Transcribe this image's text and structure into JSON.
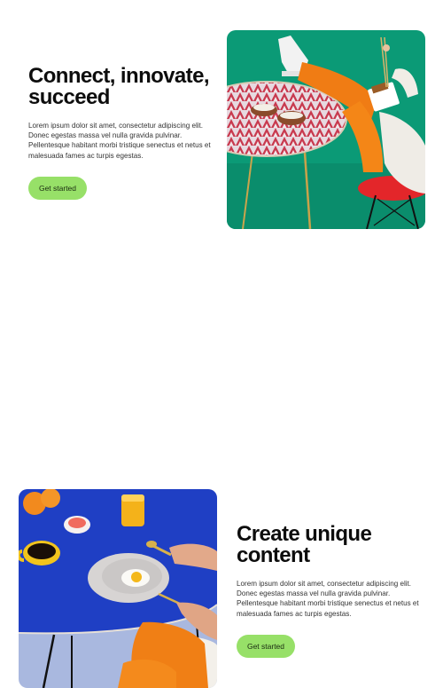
{
  "feature_1": {
    "title_line_1": "Connect, innovate,",
    "title_line_2": "succeed",
    "body": "Lorem ipsum dolor sit amet, consectetur adipiscing elit. Donec egestas massa vel nulla gravida pulvinar. Pellentesque habitant morbi tristique senectus et netus et malesuada fames ac turpis egestas.",
    "cta_label": "Get started",
    "image_icon": "photo-person-eating-at-patterned-table"
  },
  "feature_2": {
    "title_line_1": "Create unique",
    "title_line_2": "content",
    "body": "Lorem ipsum dolor sit amet, consectetur adipiscing elit. Donec egestas massa vel nulla gravida pulvinar. Pellentesque habitant morbi tristique senectus et netus et malesuada fames ac turpis egestas.",
    "cta_label": "Get started",
    "image_icon": "photo-breakfast-on-blue-table"
  },
  "colors": {
    "background": "#ffffff",
    "heading": "#0d0d0d",
    "body_text": "#333333",
    "cta_background": "#97e068",
    "photo_1_backdrop": "#0b9a76",
    "photo_2_table": "#1f3fc4"
  }
}
